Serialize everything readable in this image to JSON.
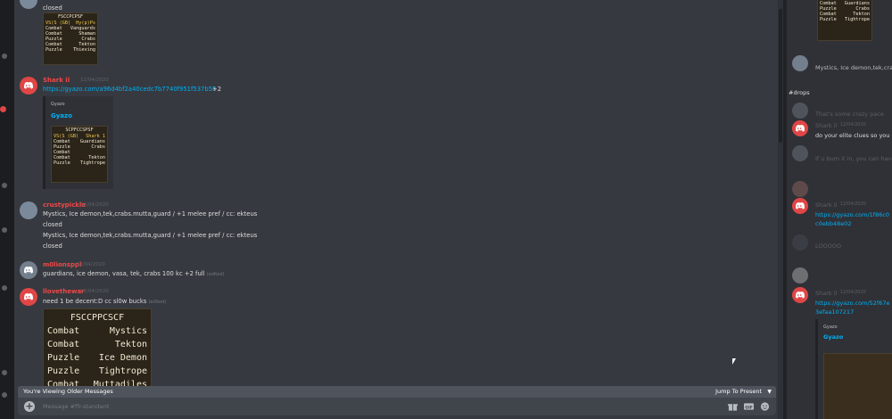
{
  "colors": {
    "chat_bg": "#36393f",
    "sidebar_bg": "#2f3136",
    "link": "#00b0f4",
    "username_red": "#f04747",
    "discord_red": "#e04646"
  },
  "messages": {
    "m0": {
      "text": "closed"
    },
    "m1": {
      "username": "Shark il",
      "timestamp": "12/04/2020",
      "link": "https://gyazo.com/a96d4bf2a40cedc7b7740f951f537b55",
      "link_suffix": "+2",
      "embed_provider": "Gyazo",
      "embed_title": "Gyazo"
    },
    "m2": {
      "username": "crustypickle",
      "timestamp": "12/04/2020",
      "lines": [
        "Mystics, Ice demon,tek,crabs.mutta,guard / +1 melee pref /  cc: ekteus",
        "closed",
        "Mystics, Ice demon,tek,crabs.mutta,guard / +1 melee pref /  cc: ekteus",
        "closed"
      ]
    },
    "m3": {
      "username": "m0lionsppl",
      "timestamp": "12/04/2020",
      "text": "guardians, ice demon, vasa, tek, crabs 100 kc +2  full",
      "edited": "(edited)"
    },
    "m4": {
      "username": "llovethewar",
      "timestamp": "12/04/2020",
      "text": "need 1 be decent:D cc sl0w bucks",
      "edited": "(edited)"
    }
  },
  "scout_small": {
    "title": "FSCCPCPSF",
    "rows": [
      [
        "VS(S (GB)",
        "Hy(p)Ps"
      ],
      [
        "Combat",
        "Vanguards"
      ],
      [
        "Combat",
        "Shaman"
      ],
      [
        "Puzzle",
        "Crabs"
      ],
      [
        "Combat",
        "Tekton"
      ],
      [
        "Puzzle",
        "Thieving"
      ]
    ]
  },
  "scout_embed": {
    "title": "SCPFCCSPSF",
    "rows": [
      [
        "VS(S (GB)",
        "Shark 1"
      ],
      [
        "Combat",
        "Guardians"
      ],
      [
        "Puzzle",
        "Crabs"
      ],
      [
        "Combat",
        ""
      ],
      [
        "Combat",
        "Tekton"
      ],
      [
        "Puzzle",
        "Tightrope"
      ]
    ]
  },
  "scout_big": {
    "title": "FSCCPPCSCF",
    "rows": [
      [
        "Combat",
        "Mystics"
      ],
      [
        "Combat",
        "Tekton"
      ],
      [
        "Puzzle",
        "Ice Demon"
      ],
      [
        "Puzzle",
        "Tightrope"
      ],
      [
        "Combat",
        "Muttadiles"
      ]
    ]
  },
  "older_bar": {
    "label": "You're Viewing Older Messages",
    "jump": "Jump To Present"
  },
  "input": {
    "placeholder": "Message #ffr-standard"
  },
  "right": {
    "scout_top": {
      "rows": [
        [
          "Combat",
          "Guardians"
        ],
        [
          "Puzzle",
          "Crabs"
        ],
        [
          "Combat",
          "Tekton"
        ],
        [
          "Puzzle",
          "Tightrope"
        ]
      ]
    },
    "r1_text": "Mystics, Ice demon,tek,crabs.mutta",
    "heading": "#drops",
    "r2_text": "That's some crazy pace",
    "r3_name": "Shark il",
    "r3_time": "12/04/2020",
    "r3_text": "do your elite clues so you ca",
    "r4_text": "If u bum it in, you can have",
    "r5_name": "Shark il",
    "r5_time": "12/04/2020",
    "r5_link1": "https://gyazo.com/1f86c0",
    "r5_link2": "c0ebb48e02",
    "r6_text": "LOOOOO",
    "r7_name": "Shark il",
    "r7_time": "12/04/2020",
    "r7_link1": "https://gyazo.com/52f67e",
    "r7_link2": "3efaa107217",
    "r7_embed_title": "Gyazo",
    "r7_embed_provider": "Gyazo"
  }
}
